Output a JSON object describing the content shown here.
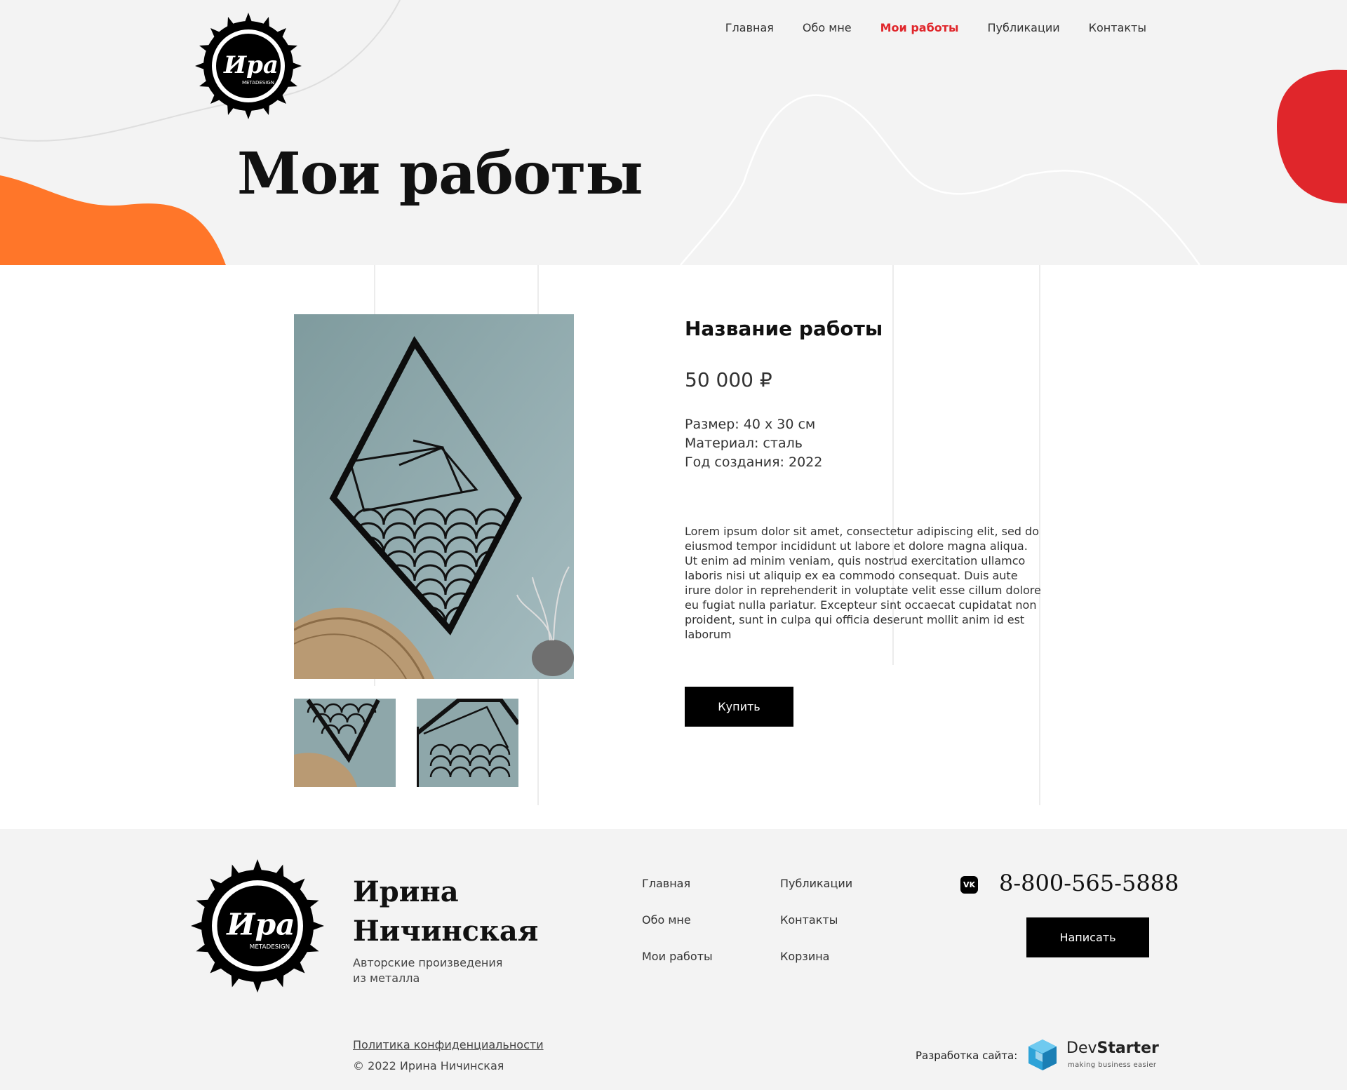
{
  "colors": {
    "accent": "#e0262b",
    "orange": "#ff7629",
    "background": "#f3f3f3",
    "button": "#000000"
  },
  "header": {
    "logo_icon": "sun-logo-icon",
    "nav": [
      {
        "label": "Главная"
      },
      {
        "label": "Обо мне"
      },
      {
        "label": "Мои работы",
        "active": true
      },
      {
        "label": "Публикации"
      },
      {
        "label": "Контакты"
      }
    ],
    "page_title": "Мои работы"
  },
  "product": {
    "title": "Название работы",
    "price": "50 000 ₽",
    "specs": {
      "size": "Размер: 40 х 30 см",
      "material": "Материал: сталь",
      "year": "Год создания: 2022"
    },
    "description": "Lorem ipsum dolor sit amet, consectetur adipiscing elit, sed do eiusmod tempor incididunt ut labore et dolore magna aliqua. Ut enim ad minim veniam, quis nostrud exercitation ullamco laboris nisi ut aliquip ex ea commodo consequat. Duis aute irure dolor in reprehenderit in voluptate velit esse cillum dolore eu fugiat nulla pariatur. Excepteur sint occaecat cupidatat non proident, sunt in culpa qui officia deserunt mollit anim id est laborum",
    "buy_label": "Купить"
  },
  "footer": {
    "name_line1": "Ирина",
    "name_line2": "Ничинская",
    "tagline_line1": "Авторские произведения",
    "tagline_line2": "из металла",
    "nav_col1": [
      "Главная",
      "Обо мне",
      "Мои работы"
    ],
    "nav_col2": [
      "Публикации",
      "Контакты",
      "Корзина"
    ],
    "vk_icon": "vk-icon",
    "vk_label": "VK",
    "phone": "8-800-565-5888",
    "write_label": "Написать",
    "policy": "Политика конфиденциальности",
    "copyright": "© 2022 Ирина Ничинская",
    "dev_label": "Разработка сайта:",
    "dev_brand_light": "Dev",
    "dev_brand_bold": "Starter",
    "dev_tagline": "making business easier"
  }
}
